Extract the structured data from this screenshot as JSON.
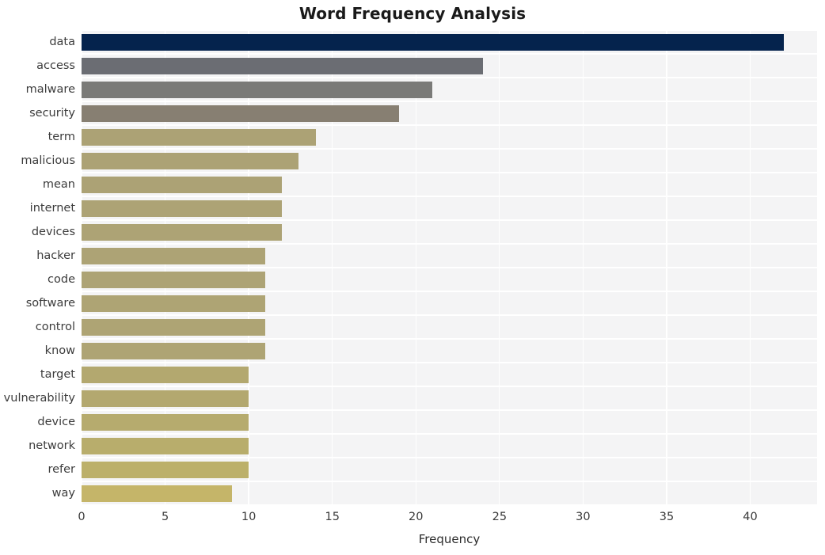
{
  "chart_data": {
    "type": "bar",
    "orientation": "horizontal",
    "title": "Word Frequency Analysis",
    "xlabel": "Frequency",
    "ylabel": "",
    "categories": [
      "data",
      "access",
      "malware",
      "security",
      "term",
      "malicious",
      "mean",
      "internet",
      "devices",
      "hacker",
      "code",
      "software",
      "control",
      "know",
      "target",
      "vulnerability",
      "device",
      "network",
      "refer",
      "way"
    ],
    "values": [
      42,
      24,
      21,
      19,
      14,
      13,
      12,
      12,
      12,
      11,
      11,
      11,
      11,
      11,
      10,
      10,
      10,
      10,
      10,
      9
    ],
    "bar_colors": [
      "#05234d",
      "#6b6d73",
      "#7a7a78",
      "#877f72",
      "#aca275",
      "#aca275",
      "#aca275",
      "#ada375",
      "#ada375",
      "#ada375",
      "#ada375",
      "#aea474",
      "#aea474",
      "#aea474",
      "#b3a86f",
      "#b3a86f",
      "#b6ab6e",
      "#b8ad6c",
      "#bcb06a",
      "#c5b569"
    ],
    "xlim": [
      0,
      44
    ],
    "xticks": [
      0,
      5,
      10,
      15,
      20,
      25,
      30,
      35,
      40
    ],
    "xtick_labels": [
      "0",
      "5",
      "10",
      "15",
      "20",
      "25",
      "30",
      "35",
      "40"
    ],
    "grid": true,
    "grid_color": "#ffffff",
    "plot_background": "#f4f4f5",
    "figure_background": "#ffffff",
    "legend": null,
    "style": "whitegrid"
  }
}
